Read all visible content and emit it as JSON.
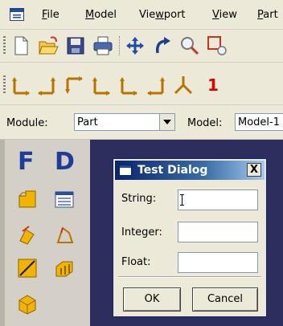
{
  "menubar": {
    "items": [
      {
        "label": "File",
        "mnemonic": "F",
        "rest": "ile"
      },
      {
        "label": "Model",
        "mnemonic": "M",
        "rest": "odel"
      },
      {
        "label": "Viewport",
        "mnemonic": "w",
        "pre": "Vie",
        "rest": "port"
      },
      {
        "label": "View",
        "mnemonic": "V",
        "rest": "iew"
      },
      {
        "label": "Part",
        "mnemonic": "P",
        "rest": "art"
      }
    ]
  },
  "toolbar1": {
    "icons": [
      "new-file-icon",
      "open-file-icon",
      "save-icon",
      "print-icon",
      "pan-icon",
      "rotate-icon",
      "zoom-icon",
      "box-zoom-icon"
    ]
  },
  "toolbar2": {
    "icons": [
      "view-front-icon",
      "view-back-icon",
      "view-top-icon",
      "view-bottom-icon",
      "view-left-icon",
      "view-right-icon",
      "view-iso-icon"
    ],
    "extra_label": "1"
  },
  "module_bar": {
    "module_label": "Module:",
    "module_value": "Part",
    "model_label": "Model:",
    "model_value": "Model-1"
  },
  "toolbox": {
    "letters": [
      "F",
      "D"
    ],
    "tools": [
      "create-part-icon",
      "part-manager-icon",
      "create-solid-extrude-icon",
      "create-shell-icon",
      "create-wire-icon",
      "create-cut-icon",
      "create-datum-icon"
    ]
  },
  "dialog": {
    "title": "Test Dialog",
    "close_glyph": "X",
    "fields": [
      {
        "label": "String:",
        "value": ""
      },
      {
        "label": "Integer:",
        "value": ""
      },
      {
        "label": "Float:",
        "value": ""
      }
    ],
    "ok_label": "OK",
    "cancel_label": "Cancel"
  },
  "colors": {
    "window_bg": "#ece9d8",
    "viewport_bg": "#2d2d5e",
    "title_gradient_start": "#0a246a",
    "accent_red": "#e00000",
    "toolbox_letter": "#1f3c9b"
  }
}
